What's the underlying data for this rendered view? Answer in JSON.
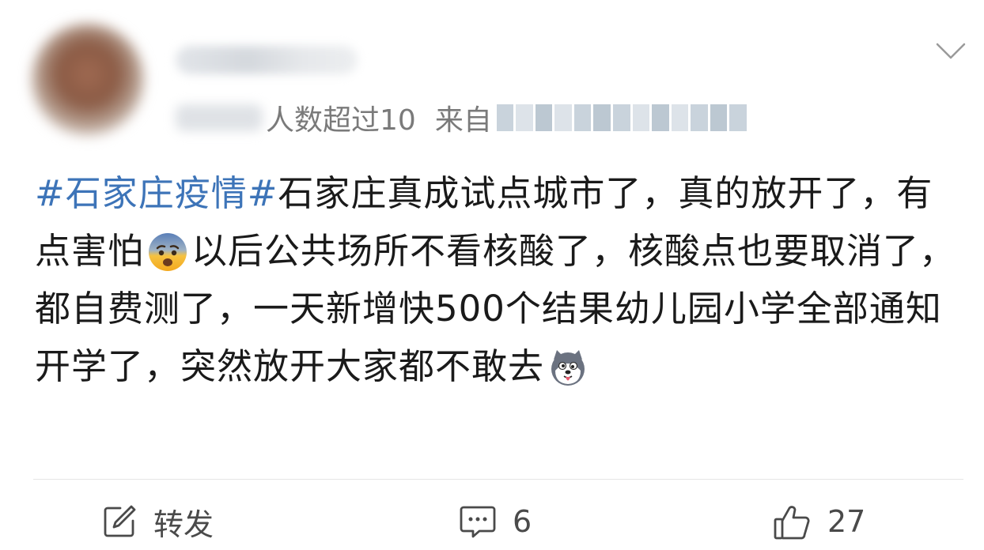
{
  "header": {
    "meta_text": "人数超过10",
    "from_label": "来自",
    "more_icon": "chevron-down-icon"
  },
  "post": {
    "hashtag": "#石家庄疫情#",
    "text": "石家庄真成试点城市了，真的放开了，有点害怕",
    "text_after_emoji1": "以后公共场所不看核酸了，核酸点也要取消了，都自费测了，一天新增快500个结果幼儿园小学全部通知开学了，突然放开大家都不敢去",
    "emoji1": "fearful-face-icon",
    "emoji2": "husky-dog-face-icon",
    "hashtag_color": "#3d74b8"
  },
  "actions": {
    "repost_label": "转发",
    "repost_icon": "share-edit-icon",
    "comment_count": "6",
    "comment_icon": "comment-bubble-icon",
    "like_count": "27",
    "like_icon": "thumbs-up-icon"
  }
}
